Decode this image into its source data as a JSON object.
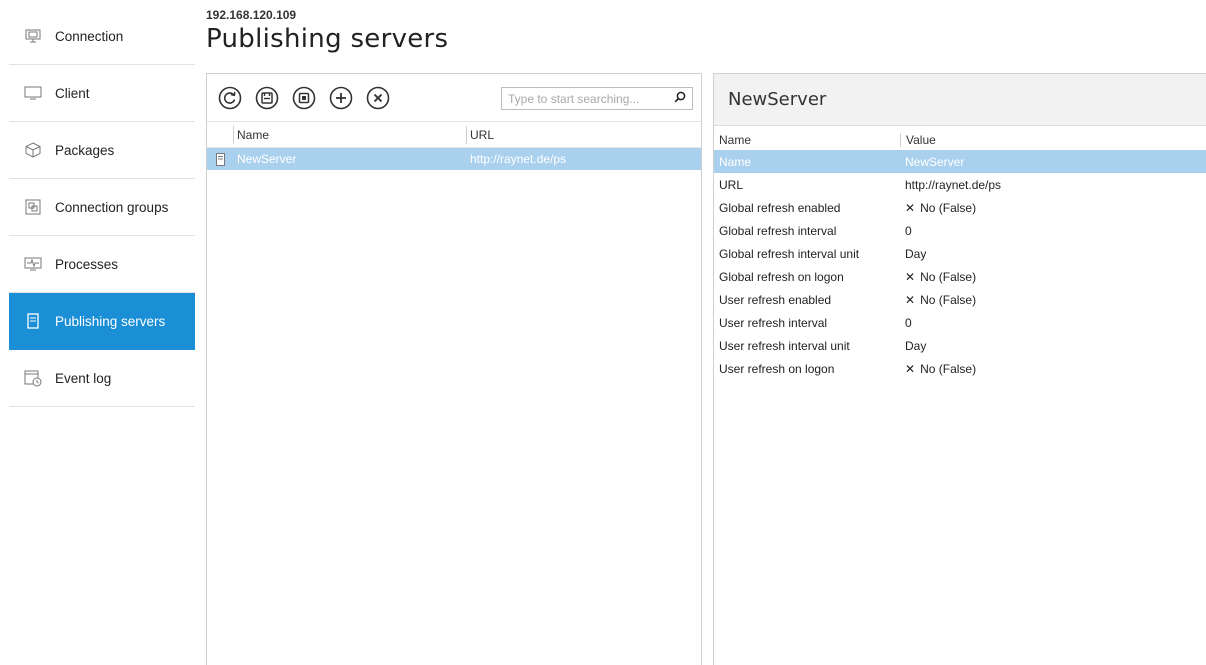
{
  "sidebar": {
    "items": [
      {
        "label": "Connection",
        "icon": "monitor-icon",
        "active": false
      },
      {
        "label": "Client",
        "icon": "client-icon",
        "active": false
      },
      {
        "label": "Packages",
        "icon": "package-icon",
        "active": false
      },
      {
        "label": "Connection groups",
        "icon": "group-icon",
        "active": false
      },
      {
        "label": "Processes",
        "icon": "process-icon",
        "active": false
      },
      {
        "label": "Publishing servers",
        "icon": "server-icon",
        "active": true
      },
      {
        "label": "Event log",
        "icon": "event-log-icon",
        "active": false
      }
    ]
  },
  "header": {
    "subtitle": "192.168.120.109",
    "title": "Publishing servers"
  },
  "toolbar": {
    "buttons": [
      "refresh-icon",
      "save-icon",
      "publish-icon",
      "add-icon",
      "remove-icon"
    ],
    "search_placeholder": "Type to start searching..."
  },
  "grid": {
    "columns": [
      "Name",
      "URL"
    ],
    "rows": [
      {
        "name": "NewServer",
        "url": "http://raynet.de/ps"
      }
    ]
  },
  "details": {
    "title": "NewServer",
    "columns": [
      "Name",
      "Value"
    ],
    "rows": [
      {
        "name": "Name",
        "value": "NewServer",
        "bool": false
      },
      {
        "name": "URL",
        "value": "http://raynet.de/ps",
        "bool": false
      },
      {
        "name": "Global refresh enabled",
        "value": "No (False)",
        "bool": true
      },
      {
        "name": "Global refresh interval",
        "value": "0",
        "bool": false
      },
      {
        "name": "Global refresh interval unit",
        "value": "Day",
        "bool": false
      },
      {
        "name": "Global refresh on logon",
        "value": "No (False)",
        "bool": true
      },
      {
        "name": "User refresh enabled",
        "value": "No (False)",
        "bool": true
      },
      {
        "name": "User refresh interval",
        "value": "0",
        "bool": false
      },
      {
        "name": "User refresh interval unit",
        "value": "Day",
        "bool": false
      },
      {
        "name": "User refresh on logon",
        "value": "No (False)",
        "bool": true
      }
    ]
  },
  "colors": {
    "accent": "#1a8fd6",
    "selection": "#a9d1ee"
  }
}
